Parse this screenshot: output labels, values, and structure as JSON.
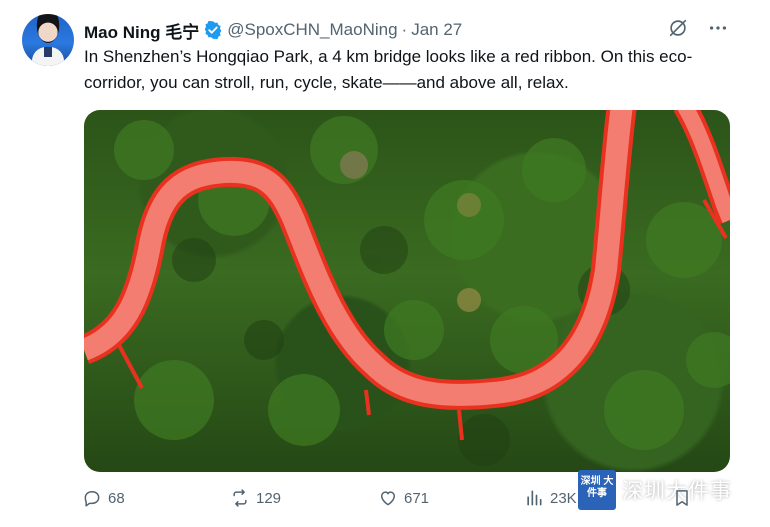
{
  "author": {
    "name": "Mao Ning 毛宁",
    "handle": "@SpoxCHN_MaoNing",
    "separator": "·",
    "date": "Jan 27"
  },
  "tweet": {
    "text": "In Shenzhen’s Hongqiao Park, a 4 km bridge looks like a red ribbon. On this eco-corridor, you can stroll, run, cycle, skate——and above all, relax."
  },
  "actions": {
    "replies": "68",
    "reposts": "129",
    "likes": "671",
    "views": "23K"
  },
  "watermark": {
    "badge": "深圳 大件事",
    "text": "深圳大件事"
  },
  "colors": {
    "verified": "#1d9bf0",
    "muted": "#536471",
    "bridge": "#f25a4a"
  },
  "icons": {
    "verified": "verified-badge-icon",
    "grok": "grok-icon",
    "more": "more-icon",
    "reply": "reply-icon",
    "repost": "repost-icon",
    "like": "like-icon",
    "views": "views-icon",
    "bookmark": "bookmark-icon"
  }
}
